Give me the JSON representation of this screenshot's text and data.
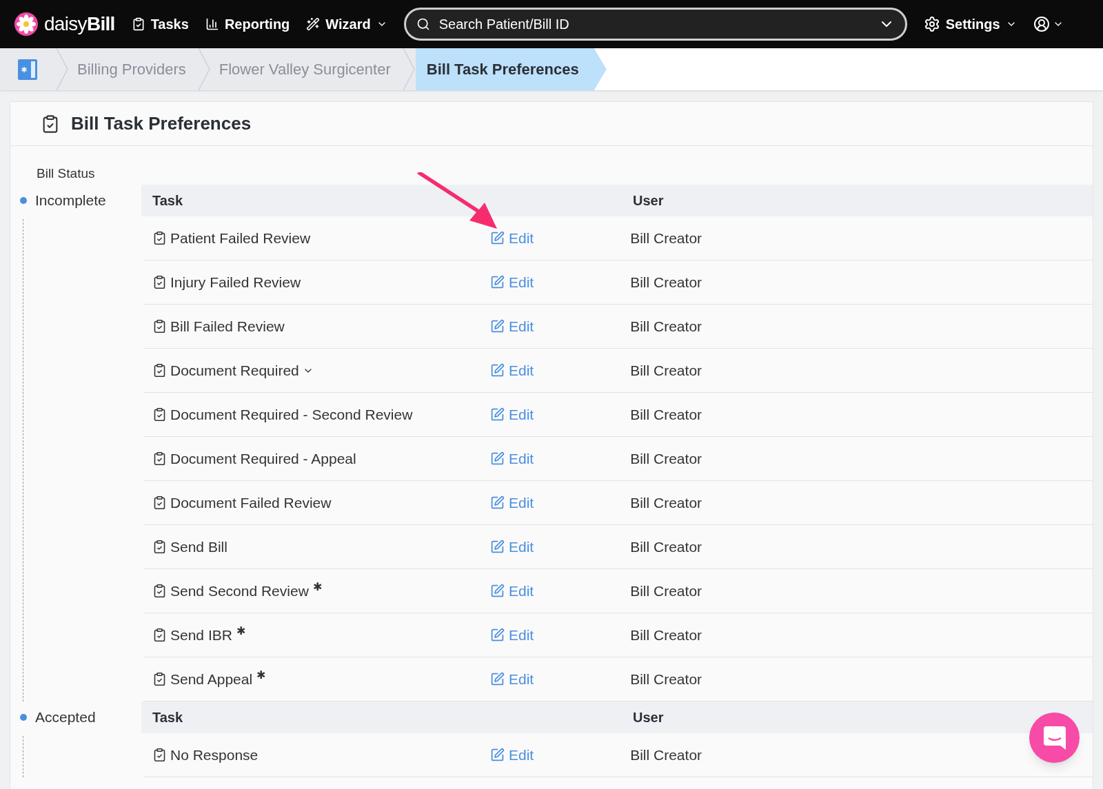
{
  "nav": {
    "logo_text_light": "daisy",
    "logo_text_bold": "Bill",
    "items": [
      {
        "label": "Tasks",
        "kind": "tasks"
      },
      {
        "label": "Reporting",
        "kind": "reporting"
      },
      {
        "label": "Wizard",
        "kind": "wizard"
      }
    ],
    "search": {
      "placeholder": "Search Patient/Bill ID"
    },
    "settings": "Settings"
  },
  "breadcrumbs": [
    {
      "label": "Billing Providers",
      "selected": false
    },
    {
      "label": "Flower Valley Surgicenter",
      "selected": false
    },
    {
      "label": "Bill Task Preferences",
      "selected": true
    }
  ],
  "page_title": "Bill Task Preferences",
  "status_heading": "Bill Status",
  "sections": [
    {
      "status": "Incomplete",
      "columns": [
        "Task",
        "User"
      ],
      "rows": [
        {
          "task": "Patient Failed Review",
          "dropdown": false,
          "action": "Edit",
          "user": "Bill Creator"
        },
        {
          "task": "Injury Failed Review",
          "dropdown": false,
          "action": "Edit",
          "user": "Bill Creator"
        },
        {
          "task": "Bill Failed Review",
          "dropdown": false,
          "action": "Edit",
          "user": "Bill Creator"
        },
        {
          "task": "Document Required",
          "dropdown": true,
          "action": "Edit",
          "user": "Bill Creator"
        },
        {
          "task": "Document Required - Second Review",
          "dropdown": false,
          "action": "Edit",
          "user": "Bill Creator"
        },
        {
          "task": "Document Required - Appeal",
          "dropdown": false,
          "action": "Edit",
          "user": "Bill Creator"
        },
        {
          "task": "Document Failed Review",
          "dropdown": false,
          "action": "Edit",
          "user": "Bill Creator"
        },
        {
          "task": "Send Bill",
          "dropdown": false,
          "action": "Edit",
          "user": "Bill Creator"
        },
        {
          "task": "Send Second Review $^{✱}$",
          "dropdown": false,
          "action": "Edit",
          "user": "Bill Creator"
        },
        {
          "task": "Send IBR $^{✱}$",
          "dropdown": false,
          "action": "Edit",
          "user": "Bill Creator"
        },
        {
          "task": "Send Appeal $^{✱}$",
          "dropdown": false,
          "action": "Edit",
          "user": "Bill Creator"
        }
      ]
    },
    {
      "status": "Accepted",
      "columns": [
        "Task",
        "User"
      ],
      "rows": [
        {
          "task": "No Response",
          "dropdown": false,
          "action": "Edit",
          "user": "Bill Creator"
        }
      ]
    }
  ]
}
